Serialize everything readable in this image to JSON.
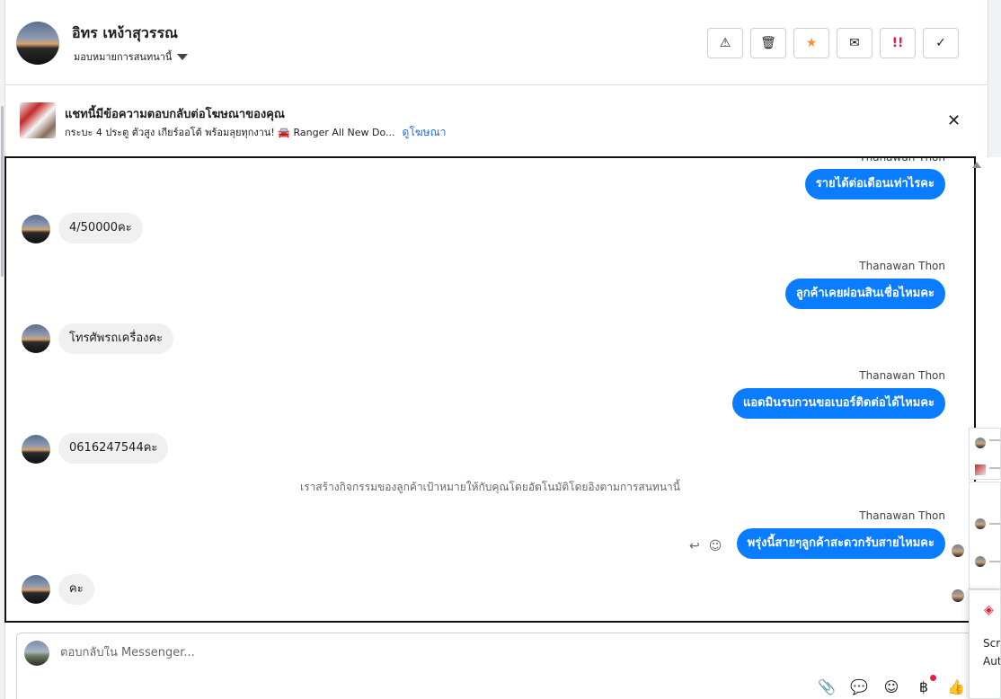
{
  "header": {
    "contact_name": "อิทร เหง้าสุวรรณ",
    "assign_label": "มอบหมายการสนทนานี้",
    "actions": {
      "spam": "⚠",
      "delete": "🗑",
      "star": "★",
      "unread": "✉",
      "urgent": "!!",
      "done": "✓"
    }
  },
  "ad_banner": {
    "title": "แชทนี้มีข้อความตอบกลับต่อโฆษณาของคุณ",
    "subtitle": "กระบะ 4 ประตู ตัวสูง เกียร์ออโต้ พร้อมลุยทุกงาน! 🚘 Ranger All New Do...",
    "link_label": "ดูโฆษณา",
    "close": "✕"
  },
  "thread": {
    "top_sender": "Thanawan Thon",
    "messages": [
      {
        "dir": "out",
        "text": "รายได้ต่อเดือนเท่าไรคะ"
      },
      {
        "dir": "in",
        "text": "4/50000คะ"
      },
      {
        "dir": "out",
        "sender": "Thanawan Thon",
        "text": "ลูกค้าเคยผ่อนสินเชื่อไหมคะ"
      },
      {
        "dir": "in",
        "text": "โทรศัพรถเครื่องคะ"
      },
      {
        "dir": "out",
        "sender": "Thanawan Thon",
        "text": "แอดมินรบกวนขอเบอร์ติดต่อได้ไหมคะ"
      },
      {
        "dir": "in",
        "text": "0616247544คะ"
      },
      {
        "dir": "system",
        "text": "เราสร้างกิจกรรมของลูกค้าเป้าหมายให้กับคุณโดยอัตโนมัติโดยอิงตามการสนทนานี้"
      },
      {
        "dir": "out",
        "sender": "Thanawan Thon",
        "text": "พรุ่งนี้สายๆลูกค้าสะดวกรับสายไหมคะ"
      },
      {
        "dir": "in",
        "text": "คะ"
      }
    ],
    "tools": {
      "reply": "↩",
      "react": "☺"
    }
  },
  "composer": {
    "placeholder": "ตอบกลับใน Messenger...",
    "tools": {
      "attach": "📎",
      "saved_reply": "💬",
      "emoji": "☺",
      "payment": "฿",
      "like": "👍"
    }
  },
  "mini_windows": {
    "text_a": "Scre",
    "text_b": "Aut"
  }
}
